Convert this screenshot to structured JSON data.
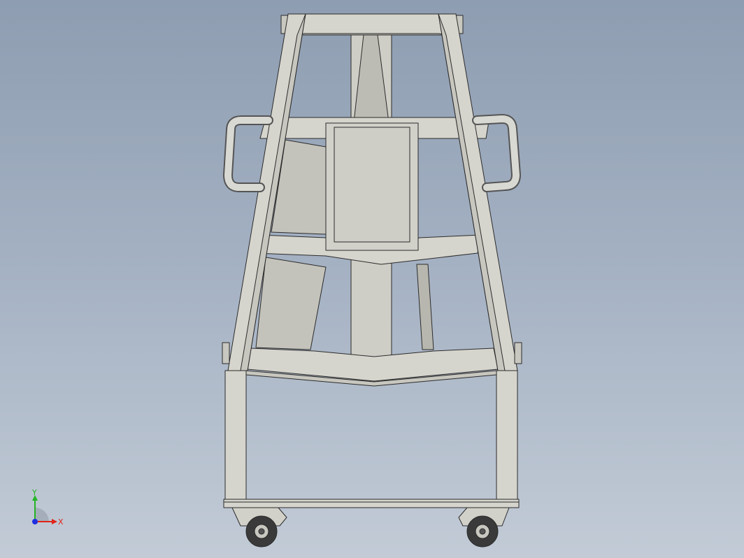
{
  "viewport": {
    "background_top": "#8e9db1",
    "background_bottom": "#c2cbd6"
  },
  "model": {
    "frame_color": "#d6d5cd",
    "frame_shade": "#bdbcb4",
    "edge_color": "#2b2b2b",
    "handle_color": "#c9c9c4",
    "wheel_color": "#3a3a3a"
  },
  "triad": {
    "x_label": "X",
    "y_label": "Y",
    "x_color": "#e0241b",
    "y_color": "#23b523",
    "z_color": "#1f2ee0"
  }
}
